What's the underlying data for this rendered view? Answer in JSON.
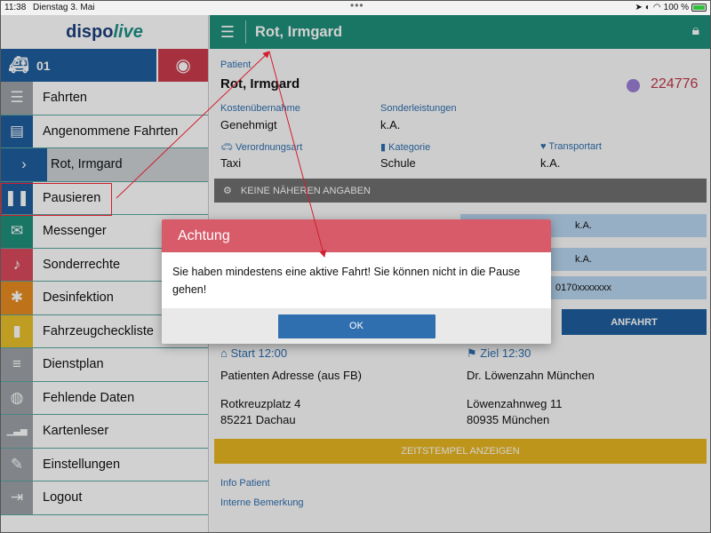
{
  "status_bar": {
    "time": "11:38",
    "date": "Dienstag 3. Mai",
    "battery": "100 %",
    "dots": "•••"
  },
  "app": {
    "logo_part1": "dispo",
    "logo_part2": "live"
  },
  "sidebar": {
    "vehicle_number": "01",
    "items": [
      {
        "label": "Fahrten",
        "icon": "list-check-icon",
        "color": "#9ea2a6"
      },
      {
        "label": "Angenommene Fahrten",
        "icon": "id-card-icon",
        "color": "#1f5f9e"
      },
      {
        "label": "Rot, Irmgard",
        "icon": "chevron-right-icon",
        "color": "#1f5f9e",
        "sub": true
      },
      {
        "label": "Pausieren",
        "icon": "pause-icon",
        "color": "#1f5f9e"
      },
      {
        "label": "Messenger",
        "icon": "envelope-icon",
        "color": "#1f8f7a"
      },
      {
        "label": "Sonderrechte",
        "icon": "bell-icon",
        "color": "#d94a5c"
      },
      {
        "label": "Desinfektion",
        "icon": "bug-icon",
        "color": "#e88b1f"
      },
      {
        "label": "Fahrzeugcheckliste",
        "icon": "book-icon",
        "color": "#e8c02a"
      },
      {
        "label": "Dienstplan",
        "icon": "list-icon",
        "color": "#9ea2a6"
      },
      {
        "label": "Fehlende Daten",
        "icon": "database-icon",
        "color": "#9ea2a6"
      },
      {
        "label": "Kartenleser",
        "icon": "signal-icon",
        "color": "#9ea2a6"
      },
      {
        "label": "Einstellungen",
        "icon": "wrench-icon",
        "color": "#9ea2a6"
      },
      {
        "label": "Logout",
        "icon": "sign-out-icon",
        "color": "#9ea2a6"
      }
    ]
  },
  "topbar": {
    "title": "Rot, Irmgard"
  },
  "patient": {
    "label": "Patient",
    "name": "Rot, Irmgard",
    "id": "224776",
    "kostenuebernahme_label": "Kostenübernahme",
    "kostenuebernahme": "Genehmigt",
    "sonderleistungen_label": "Sonderleistungen",
    "sonderleistungen": "k.A.",
    "verordnungsart_label": "Verordnungsart",
    "verordnungsart": "Taxi",
    "kategorie_label": "Kategorie",
    "kategorie": "Schule",
    "transportart_label": "Transportart",
    "transportart": "k.A."
  },
  "details_bar": "KEINE NÄHEREN ANGABEN",
  "fields": {
    "field1": "k.A.",
    "field2": "k.A.",
    "phone": "0170xxxxxxx"
  },
  "anfahrt_button": "ANFAHRT",
  "start": {
    "label": "Start 12:00",
    "name": "Patienten Adresse (aus FB)",
    "street": "Rotkreuzplatz 4",
    "city": "85221 Dachau"
  },
  "ziel": {
    "label": "Ziel 12:30",
    "name": "Dr. Löwenzahn München",
    "street": "Löwenzahnweg 11",
    "city": "80935 München"
  },
  "timestamp_button": "ZEITSTEMPEL ANZEIGEN",
  "info_patient": "Info Patient",
  "interne_bemerkung": "Interne Bemerkung",
  "dialog": {
    "title": "Achtung",
    "message": "Sie haben mindestens eine aktive Fahrt! Sie können nicht in die Pause gehen!",
    "ok_label": "OK"
  }
}
